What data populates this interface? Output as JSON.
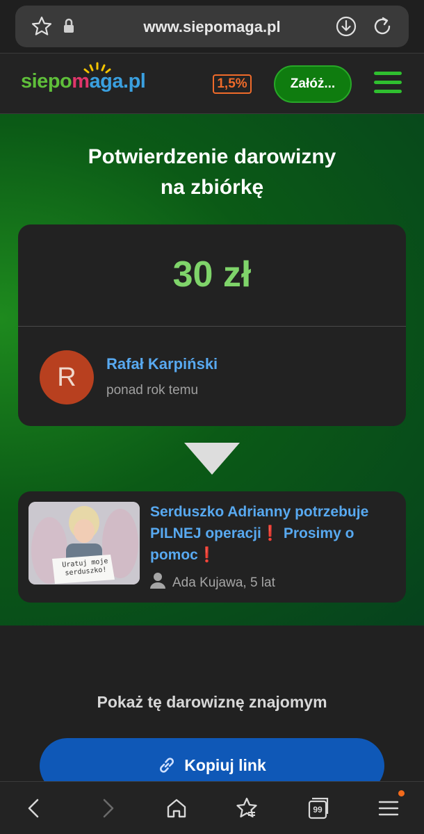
{
  "browser": {
    "url": "www.siepomaga.pl",
    "tab_count": "99"
  },
  "header": {
    "logo_part1": "siepo",
    "logo_part2": "m",
    "logo_part3": "aga.pl",
    "tax_badge": "1,5%",
    "create_button": "Załóż..."
  },
  "page": {
    "title_line1": "Potwierdzenie darowizny",
    "title_line2": "na zbiórkę"
  },
  "donation": {
    "amount": "30 zł",
    "donor_initial": "R",
    "donor_name": "Rafał Karpiński",
    "donor_time": "ponad rok temu",
    "avatar_color": "#b8401f"
  },
  "fundraiser": {
    "title": "Serduszko Adrianny potrzebuje PILNEJ operacji❗ Prosimy o pomoc❗",
    "beneficiary": "Ada Kujawa, 5 lat",
    "image_sign_text_line1": "Uratuj moje",
    "image_sign_text_line2": "serduszko!"
  },
  "share": {
    "label": "Pokaż tę darowiznę znajomym",
    "copy_button": "Kopiuj link"
  },
  "colors": {
    "accent_green": "#2fbf2f",
    "amount_green": "#7fd46a",
    "link_blue": "#58a9f0",
    "button_blue": "#0f58b7",
    "badge_orange": "#f06b2a"
  }
}
